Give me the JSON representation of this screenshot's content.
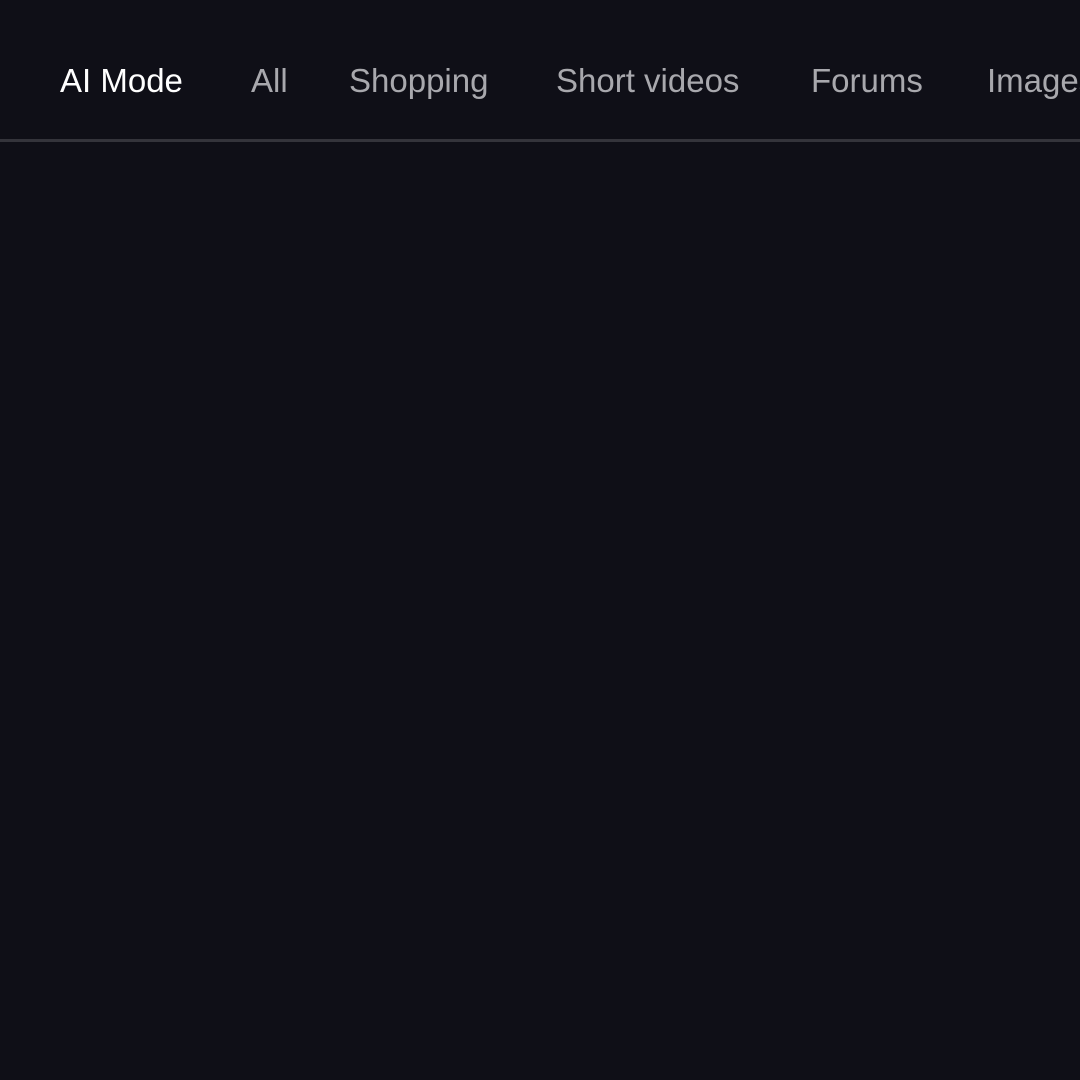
{
  "tabs": [
    {
      "label": "AI Mode",
      "active": true
    },
    {
      "label": "All",
      "active": false
    },
    {
      "label": "Shopping",
      "active": false
    },
    {
      "label": "Short videos",
      "active": false
    },
    {
      "label": "Forums",
      "active": false
    },
    {
      "label": "Images",
      "active": false
    }
  ],
  "colors": {
    "background": "#0f0f17",
    "active_tab_text": "#ffffff",
    "inactive_tab_text": "#a8a8ad",
    "divider": "#34343b"
  }
}
